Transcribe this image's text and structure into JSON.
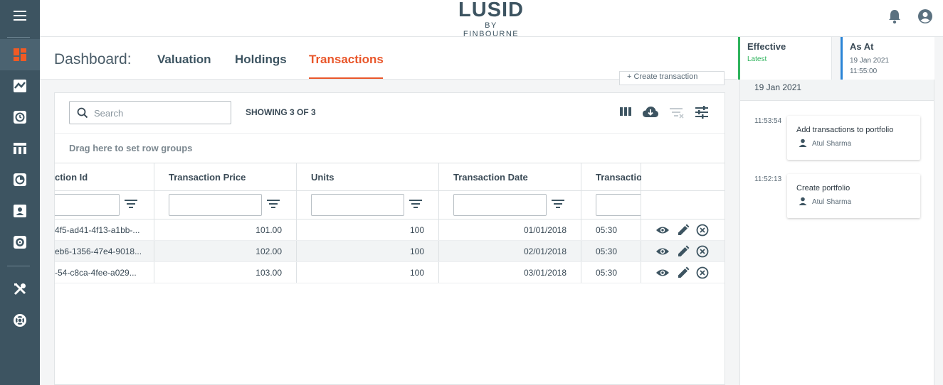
{
  "logo": {
    "title": "LUSID",
    "subtitle": "BY FINBOURNE"
  },
  "dashboard": {
    "title": "Dashboard:",
    "tabs": [
      {
        "label": "Valuation",
        "active": false
      },
      {
        "label": "Holdings",
        "active": false
      },
      {
        "label": "Transactions",
        "active": true
      }
    ]
  },
  "effective": {
    "title": "Effective",
    "value": "Latest"
  },
  "as_at": {
    "title": "As At",
    "date": "19 Jan 2021",
    "time": "11:55:00"
  },
  "create_button": {
    "label": "+ Create transaction"
  },
  "search": {
    "placeholder": "Search",
    "value": ""
  },
  "showing": "SHOWING 3 OF 3",
  "drag_text": "Drag here to set row groups",
  "columns": [
    "ction Id",
    "Transaction Price",
    "Units",
    "Transaction Date",
    "Transactio"
  ],
  "rows": [
    {
      "id": "4f5-ad41-4f13-a1bb-...",
      "price": "101.00",
      "units": "100",
      "date": "01/01/2018",
      "time": "05:30"
    },
    {
      "id": "eb6-1356-47e4-9018...",
      "price": "102.00",
      "units": "100",
      "date": "02/01/2018",
      "time": "05:30"
    },
    {
      "id": "-54-c8ca-4fee-a029...",
      "price": "103.00",
      "units": "100",
      "date": "03/01/2018",
      "time": "05:30"
    }
  ],
  "activity": {
    "date": "19 Jan 2021",
    "events": [
      {
        "time": "11:53:54",
        "title": "Add transactions to portfolio",
        "user": "Atul Sharma"
      },
      {
        "time": "11:52:13",
        "title": "Create portfolio",
        "user": "Atul Sharma"
      }
    ]
  },
  "colors": {
    "sidebar": "#3d5461",
    "accent": "#e9562a",
    "effective": "#2eb35c",
    "as_at": "#2a84d6",
    "active_icon": "#f15a24"
  },
  "icons": [
    "menu-icon",
    "dashboard-icon",
    "chart-icon",
    "clock-icon",
    "table-icon",
    "pie-icon",
    "person-icon",
    "settings-icon",
    "tools-icon",
    "lifebuoy-icon",
    "bell-icon",
    "user-icon"
  ]
}
